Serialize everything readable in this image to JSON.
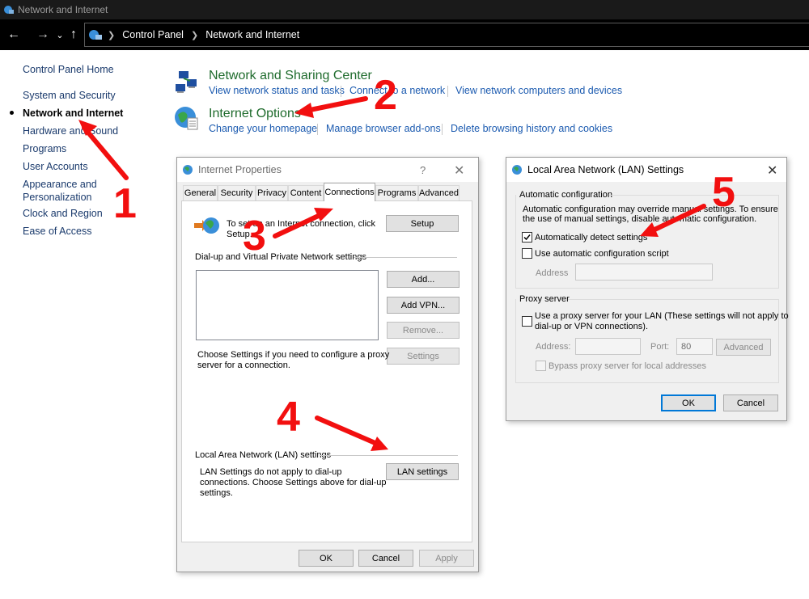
{
  "window": {
    "title": "Network and Internet"
  },
  "address": {
    "crumbs": [
      "Control Panel",
      "Network and Internet"
    ]
  },
  "sidebar": {
    "items": [
      {
        "label": "Control Panel Home"
      },
      {
        "label": "System and Security"
      },
      {
        "label": "Network and Internet",
        "active": true
      },
      {
        "label": "Hardware and Sound"
      },
      {
        "label": "Programs"
      },
      {
        "label": "User Accounts"
      },
      {
        "label": "Appearance and Personalization"
      },
      {
        "label": "Clock and Region"
      },
      {
        "label": "Ease of Access"
      }
    ],
    "appearance_lines": [
      "Appearance and",
      "Personalization"
    ]
  },
  "categories": [
    {
      "title": "Network and Sharing Center",
      "links": [
        "View network status and tasks",
        "Connect to a network",
        "View network computers and devices"
      ]
    },
    {
      "title": "Internet Options",
      "links": [
        "Change your homepage",
        "Manage browser add-ons",
        "Delete browsing history and cookies"
      ]
    }
  ],
  "internet_properties": {
    "title": "Internet Properties",
    "help": "?",
    "tabs": [
      "General",
      "Security",
      "Privacy",
      "Content",
      "Connections",
      "Programs",
      "Advanced"
    ],
    "active_tab": "Connections",
    "setup_text_1": "To set up an Internet connection, click",
    "setup_text_2": "Setup.",
    "setup_button": "Setup",
    "dialup_header": "Dial-up and Virtual Private Network settings",
    "add_button": "Add...",
    "add_vpn_button": "Add VPN...",
    "remove_button": "Remove...",
    "settings_button": "Settings",
    "proxy_text_1": "Choose Settings if you need to configure a proxy",
    "proxy_text_2": "server for a connection.",
    "lan_header": "Local Area Network (LAN) settings",
    "lan_text_1": "LAN Settings do not apply to dial-up",
    "lan_text_2": "connections. Choose Settings above for dial-up",
    "lan_text_3": "settings.",
    "lan_button": "LAN settings",
    "ok": "OK",
    "cancel": "Cancel",
    "apply": "Apply"
  },
  "lan_settings": {
    "title": "Local Area Network (LAN) Settings",
    "auto_header": "Automatic configuration",
    "auto_text_1": "Automatic configuration may override manual settings. To ensure",
    "auto_text_2": "the use of manual settings, disable automatic configuration.",
    "auto_detect_label": "Automatically detect settings",
    "auto_detect_checked": true,
    "script_label": "Use automatic configuration script",
    "script_checked": false,
    "address_label": "Address",
    "proxy_header": "Proxy server",
    "proxy_label_1": "Use a proxy server for your LAN (These settings will not apply to",
    "proxy_label_2": "dial-up or VPN connections).",
    "proxy_checked": false,
    "proxy_address_label": "Address:",
    "port_label": "Port:",
    "port_value": "80",
    "advanced_button": "Advanced",
    "bypass_label": "Bypass proxy server for local addresses",
    "ok": "OK",
    "cancel": "Cancel"
  },
  "annotations": [
    "1",
    "2",
    "3",
    "4",
    "5"
  ],
  "colors": {
    "annotation": "#f20f0f",
    "link": "#1c5bb0",
    "category_title": "#1e6b2c"
  }
}
